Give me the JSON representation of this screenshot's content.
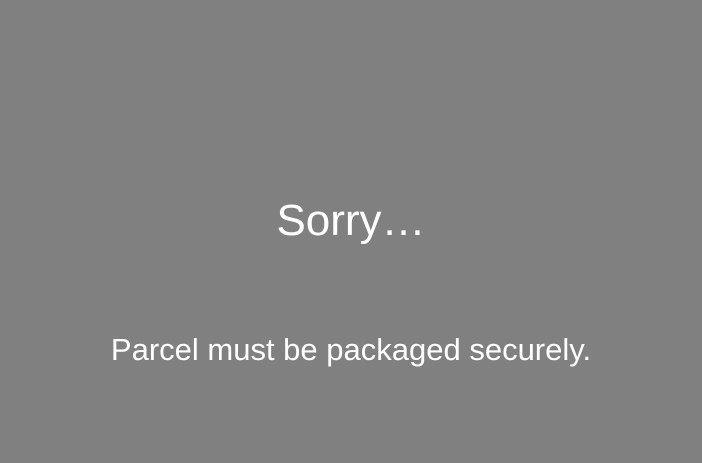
{
  "screen": {
    "title": "Sorry…",
    "message": "Parcel must be packaged securely."
  },
  "colors": {
    "background": "#808080",
    "text": "#ffffff"
  }
}
